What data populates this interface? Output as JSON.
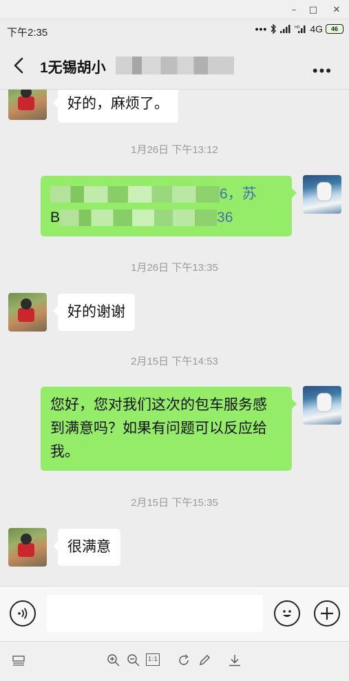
{
  "window": {
    "minimize": "–",
    "maximize": "□",
    "close": "✕"
  },
  "status_bar": {
    "time": "下午2:35",
    "network": "4G",
    "battery": "46"
  },
  "header": {
    "title": "1无锡胡小"
  },
  "messages": [
    {
      "side": "left",
      "text": "好的，麻烦了。"
    },
    {
      "side": "time",
      "text": "1月26日 下午13:12"
    },
    {
      "side": "right",
      "line1_tail": "6，苏",
      "line2_head": "B",
      "line2_tail": "36"
    },
    {
      "side": "time",
      "text": "1月26日 下午13:35"
    },
    {
      "side": "left",
      "text": "好的谢谢"
    },
    {
      "side": "time",
      "text": "2月15日 下午14:53"
    },
    {
      "side": "right",
      "lines": [
        "您好，您对我们这次的包车服务感",
        "到满意吗？如果有问题可以反应给",
        "我。"
      ]
    },
    {
      "side": "time",
      "text": "2月15日 下午15:35"
    },
    {
      "side": "left",
      "text": "很满意"
    }
  ],
  "input": {
    "placeholder": ""
  },
  "toolbar": {
    "actual_size": "1:1"
  }
}
